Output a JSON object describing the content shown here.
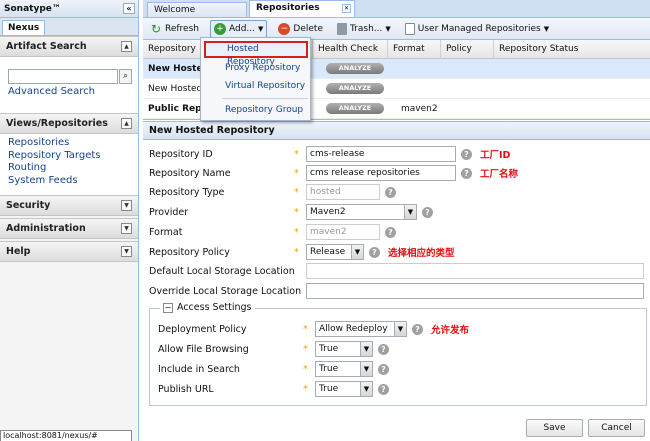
{
  "left": {
    "brand": "Sonatype™",
    "tab": "Nexus",
    "artifact_search": {
      "title": "Artifact Search",
      "search_placeholder": "",
      "advanced_link": "Advanced Search"
    },
    "views": {
      "title": "Views/Repositories",
      "links": [
        "Repositories",
        "Repository Targets",
        "Routing",
        "System Feeds"
      ]
    },
    "security": "Security",
    "administration": "Administration",
    "help": "Help",
    "status_url": "localhost:8081/nexus/#"
  },
  "tabs": [
    "Welcome",
    "Repositories"
  ],
  "toolbar": {
    "refresh": "Refresh",
    "add": "Add...",
    "delete": "Delete",
    "trash": "Trash...",
    "user_managed": "User Managed Repositories"
  },
  "add_menu": {
    "items": [
      "Hosted Repository",
      "Proxy Repository",
      "Virtual Repository",
      "Repository Group"
    ]
  },
  "grid": {
    "columns": [
      "Repository",
      "Health Check",
      "Format",
      "Policy",
      "Repository Status"
    ],
    "rows": [
      {
        "name": "New Hosted R",
        "health": "ANALYZE",
        "format": "",
        "policy": "",
        "status": ""
      },
      {
        "name": "New Hosted R",
        "health": "ANALYZE",
        "format": "",
        "policy": "",
        "status": ""
      },
      {
        "name": "Public Repos",
        "health": "ANALYZE",
        "format": "maven2",
        "policy": "",
        "status": ""
      }
    ]
  },
  "form": {
    "title": "New Hosted Repository",
    "repo_id_label": "Repository ID",
    "repo_id_value": "cms-release",
    "repo_id_note": "工厂ID",
    "repo_name_label": "Repository Name",
    "repo_name_value": "cms release repositories",
    "repo_name_note": "工厂名称",
    "repo_type_label": "Repository Type",
    "repo_type_value": "hosted",
    "provider_label": "Provider",
    "provider_value": "Maven2",
    "format_label": "Format",
    "format_value": "maven2",
    "policy_label": "Repository Policy",
    "policy_value": "Release",
    "policy_note": "选择相应的类型",
    "default_storage_label": "Default Local Storage Location",
    "default_storage_value": "",
    "override_storage_label": "Override Local Storage Location",
    "override_storage_value": "",
    "access": {
      "legend": "Access Settings",
      "deploy_label": "Deployment Policy",
      "deploy_value": "Allow Redeploy",
      "deploy_note": "允许发布",
      "browse_label": "Allow File Browsing",
      "browse_value": "True",
      "search_label": "Include in Search",
      "search_value": "True",
      "publish_label": "Publish URL",
      "publish_value": "True"
    },
    "save": "Save",
    "cancel": "Cancel"
  }
}
